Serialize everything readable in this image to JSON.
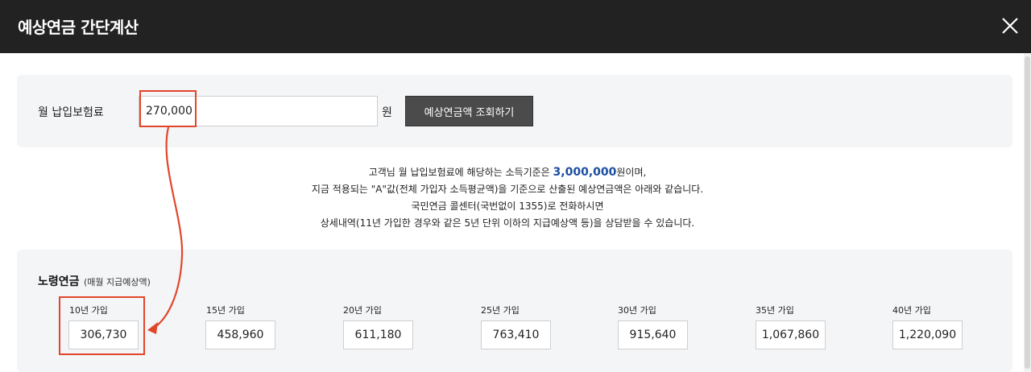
{
  "header": {
    "title": "예상연금 간단계산"
  },
  "input": {
    "label": "월 납입보험료",
    "value": "270,000",
    "unit": "원",
    "button": "예상연금액 조회하기"
  },
  "info": {
    "line1_pre": "고객님 월 납입보험료에 해당하는 소득기준은 ",
    "line1_amount": "3,000,000",
    "line1_post": "원이며,",
    "line2": "지금 적용되는 \"A\"값(전체 가입자 소득평균액)을 기준으로 산출된 예상연금액은 아래와 같습니다.",
    "line3": "국민연금 콜센터(국번없이 1355)로 전화하시면",
    "line4": "상세내역(11년 가입한 경우와 같은 5년 단위 이하의 지급예상액 등)을 상담받을 수 있습니다."
  },
  "result": {
    "title": "노령연금",
    "subtitle": "(매월 지급예상액)",
    "periods": [
      {
        "label": "10년 가입",
        "value": "306,730"
      },
      {
        "label": "15년 가입",
        "value": "458,960"
      },
      {
        "label": "20년 가입",
        "value": "611,180"
      },
      {
        "label": "25년 가입",
        "value": "763,410"
      },
      {
        "label": "30년 가입",
        "value": "915,640"
      },
      {
        "label": "35년 가입",
        "value": "1,067,860"
      },
      {
        "label": "40년 가입",
        "value": "1,220,090"
      }
    ]
  },
  "colors": {
    "header": "#222222",
    "highlight": "#1c4fa0",
    "annotation": "#e2462a"
  },
  "icons": {
    "close": "close-icon"
  }
}
